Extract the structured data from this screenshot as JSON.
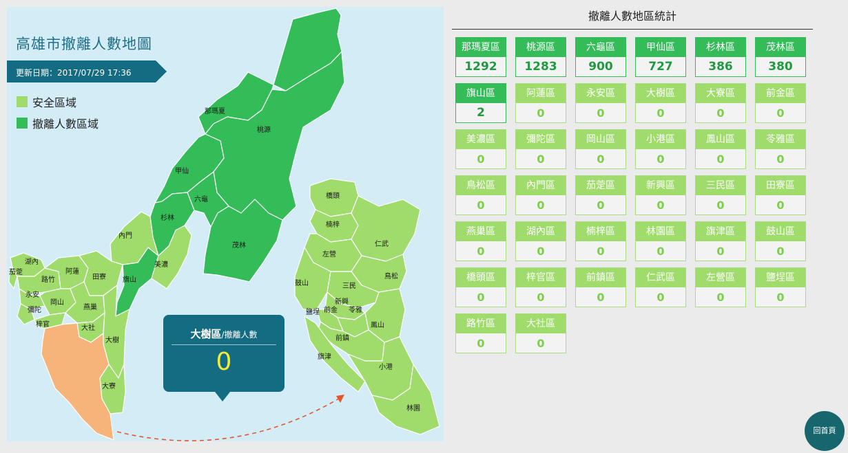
{
  "map": {
    "title": "高雄市撤離人數地圖",
    "update": "更新日期：2017/07/29 17:36",
    "legend": [
      {
        "label": "安全區域",
        "color": "#9fdc6b"
      },
      {
        "label": "撤離人數區域",
        "color": "#33bc57"
      }
    ],
    "labels": {
      "namaxia": "那瑪夏",
      "taoyuan": "桃源",
      "jiaxian": "甲仙",
      "liugui": "六龜",
      "shanlin": "杉林",
      "maolin": "茂林",
      "neimen": "內門",
      "meinong": "美濃",
      "qishan": "旗山",
      "hunei": "湖內",
      "jiading": "茄萣",
      "luzhu": "路竹",
      "alian": "阿蓮",
      "tianliao": "田寮",
      "yongan": "永安",
      "gangshan": "岡山",
      "mituo": "彌陀",
      "yanchao": "燕巢",
      "ziguan": "梓官",
      "dashe": "大社",
      "dashu": "大樹",
      "daliao": "大寮",
      "qiaotou": "橋頭",
      "nanzi": "楠梓",
      "renwu": "仁武",
      "zuoying": "左營",
      "niaosong": "鳥松",
      "gushan": "鼓山",
      "sanmin": "三民",
      "xinxing": "新興",
      "yancheng": "鹽埕",
      "qianjin": "前金",
      "lingya": "苓雅",
      "fengshan": "鳳山",
      "qianzhen": "前鎮",
      "qijin": "旗津",
      "xiaogang": "小港",
      "linyuan": "林園"
    },
    "tooltip": {
      "district": "大樹區",
      "sub": "/撤離人數",
      "value": "0"
    }
  },
  "stats": {
    "title": "撤離人數地區統計",
    "districts": [
      {
        "name": "那瑪夏區",
        "value": "1292",
        "evac": true
      },
      {
        "name": "桃源區",
        "value": "1283",
        "evac": true
      },
      {
        "name": "六龜區",
        "value": "900",
        "evac": true
      },
      {
        "name": "甲仙區",
        "value": "727",
        "evac": true
      },
      {
        "name": "杉林區",
        "value": "386",
        "evac": true
      },
      {
        "name": "茂林區",
        "value": "380",
        "evac": true
      },
      {
        "name": "旗山區",
        "value": "2",
        "evac": true
      },
      {
        "name": "阿蓮區",
        "value": "0",
        "evac": false
      },
      {
        "name": "永安區",
        "value": "0",
        "evac": false
      },
      {
        "name": "大樹區",
        "value": "0",
        "evac": false
      },
      {
        "name": "大寮區",
        "value": "0",
        "evac": false
      },
      {
        "name": "前金區",
        "value": "0",
        "evac": false
      },
      {
        "name": "美濃區",
        "value": "0",
        "evac": false
      },
      {
        "name": "彌陀區",
        "value": "0",
        "evac": false
      },
      {
        "name": "岡山區",
        "value": "0",
        "evac": false
      },
      {
        "name": "小港區",
        "value": "0",
        "evac": false
      },
      {
        "name": "鳳山區",
        "value": "0",
        "evac": false
      },
      {
        "name": "苓雅區",
        "value": "0",
        "evac": false
      },
      {
        "name": "鳥松區",
        "value": "0",
        "evac": false
      },
      {
        "name": "內門區",
        "value": "0",
        "evac": false
      },
      {
        "name": "茄萣區",
        "value": "0",
        "evac": false
      },
      {
        "name": "新興區",
        "value": "0",
        "evac": false
      },
      {
        "name": "三民區",
        "value": "0",
        "evac": false
      },
      {
        "name": "田寮區",
        "value": "0",
        "evac": false
      },
      {
        "name": "燕巢區",
        "value": "0",
        "evac": false
      },
      {
        "name": "湖內區",
        "value": "0",
        "evac": false
      },
      {
        "name": "楠梓區",
        "value": "0",
        "evac": false
      },
      {
        "name": "林園區",
        "value": "0",
        "evac": false
      },
      {
        "name": "旗津區",
        "value": "0",
        "evac": false
      },
      {
        "name": "鼓山區",
        "value": "0",
        "evac": false
      },
      {
        "name": "橋頭區",
        "value": "0",
        "evac": false
      },
      {
        "name": "梓官區",
        "value": "0",
        "evac": false
      },
      {
        "name": "前鎮區",
        "value": "0",
        "evac": false
      },
      {
        "name": "仁武區",
        "value": "0",
        "evac": false
      },
      {
        "name": "左營區",
        "value": "0",
        "evac": false
      },
      {
        "name": "鹽埕區",
        "value": "0",
        "evac": false
      },
      {
        "name": "路竹區",
        "value": "0",
        "evac": false
      },
      {
        "name": "大社區",
        "value": "0",
        "evac": false
      }
    ]
  },
  "home_button": "回首頁"
}
